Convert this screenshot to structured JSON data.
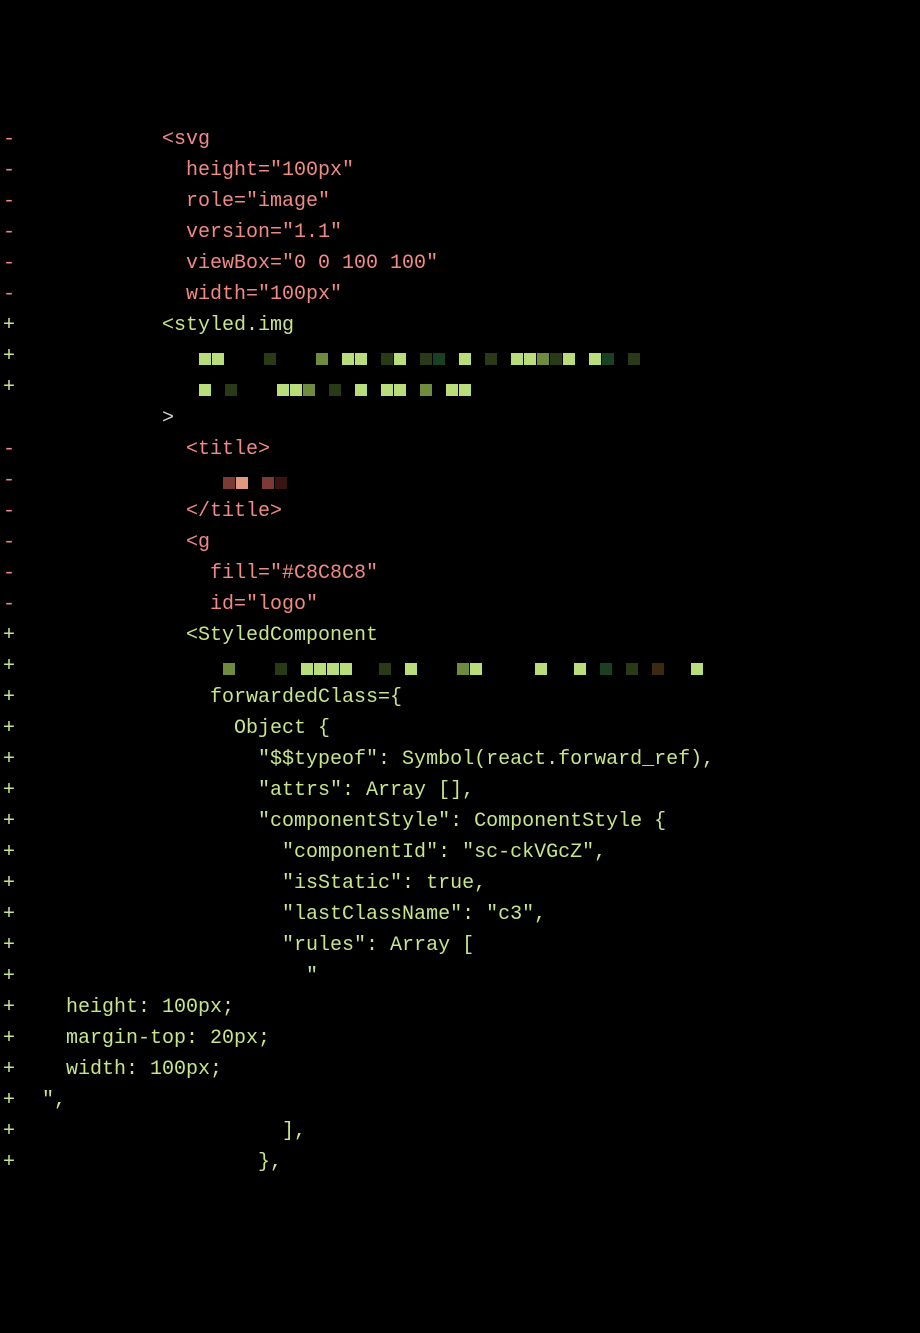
{
  "diff": {
    "markers": {
      "del": "-",
      "add": "+",
      "ctx": " "
    },
    "lines": [
      {
        "t": "del",
        "text": "          <svg"
      },
      {
        "t": "del",
        "text": "            height=\"100px\""
      },
      {
        "t": "del",
        "text": "            role=\"image\""
      },
      {
        "t": "del",
        "text": "            version=\"1.1\""
      },
      {
        "t": "del",
        "text": "            viewBox=\"0 0 100 100\""
      },
      {
        "t": "del",
        "text": "            width=\"100px\""
      },
      {
        "t": "add",
        "text": "          <styled.img"
      },
      {
        "t": "add",
        "text": "",
        "pix": "a"
      },
      {
        "t": "add",
        "text": "",
        "pix": "b"
      },
      {
        "t": "ctx",
        "text": "          >"
      },
      {
        "t": "del",
        "text": "            <title>"
      },
      {
        "t": "del",
        "text": "",
        "pix": "c"
      },
      {
        "t": "del",
        "text": "            </title>"
      },
      {
        "t": "del",
        "text": "            <g"
      },
      {
        "t": "del",
        "text": "              fill=\"#C8C8C8\""
      },
      {
        "t": "del",
        "text": "              id=\"logo\""
      },
      {
        "t": "add",
        "text": "            <StyledComponent"
      },
      {
        "t": "add",
        "text": "",
        "pix": "d"
      },
      {
        "t": "add",
        "text": "              forwardedClass={"
      },
      {
        "t": "add",
        "text": "                Object {"
      },
      {
        "t": "add",
        "text": "                  \"$$typeof\": Symbol(react.forward_ref),"
      },
      {
        "t": "add",
        "text": "                  \"attrs\": Array [],"
      },
      {
        "t": "add",
        "text": "                  \"componentStyle\": ComponentStyle {"
      },
      {
        "t": "add",
        "text": "                    \"componentId\": \"sc-ckVGcZ\","
      },
      {
        "t": "add",
        "text": "                    \"isStatic\": true,"
      },
      {
        "t": "add",
        "text": "                    \"lastClassName\": \"c3\","
      },
      {
        "t": "add",
        "text": "                    \"rules\": Array ["
      },
      {
        "t": "add",
        "text": "                      \""
      },
      {
        "t": "add",
        "text": "  height: 100px;"
      },
      {
        "t": "add",
        "text": "  margin-top: 20px;"
      },
      {
        "t": "add",
        "text": "  width: 100px;"
      },
      {
        "t": "add",
        "text": "\","
      },
      {
        "t": "add",
        "text": "                    ],"
      },
      {
        "t": "add",
        "text": "                  },"
      }
    ]
  },
  "pixpatterns": {
    "a": [
      "pk",
      "pa",
      "pa",
      "pk",
      "pk",
      "pk",
      "pb",
      "pk",
      "pk",
      "pk",
      "pc",
      "pk",
      "pa",
      "pa",
      "pk",
      "pb",
      "pa",
      "pk",
      "pb",
      "pe",
      "pk",
      "pa",
      "pk",
      "pb",
      "pk",
      "pa",
      "pa",
      "pc",
      "pb",
      "pa",
      "pk",
      "pa",
      "pe",
      "pk",
      "pb"
    ],
    "b": [
      "pk",
      "pa",
      "pk",
      "pb",
      "pk",
      "pk",
      "pk",
      "pa",
      "pa",
      "pc",
      "pk",
      "pb",
      "pk",
      "pa",
      "pk",
      "pa",
      "pa",
      "pk",
      "pc",
      "pk",
      "pa",
      "pa"
    ],
    "c": [
      "pk",
      "pi",
      "ph",
      "pk",
      "pi",
      "pg"
    ],
    "d": [
      "pk",
      "pc",
      "pk",
      "pk",
      "pk",
      "pb",
      "pk",
      "pa",
      "pa",
      "pa",
      "pa",
      "pk",
      "pk",
      "pb",
      "pk",
      "pa",
      "pk",
      "pk",
      "pk",
      "pc",
      "pa",
      "pk",
      "pk",
      "pk",
      "pk",
      "pa",
      "pk",
      "pk",
      "pa",
      "pk",
      "pe",
      "pk",
      "pb",
      "pk",
      "pd",
      "pk",
      "pk",
      "pa"
    ]
  }
}
